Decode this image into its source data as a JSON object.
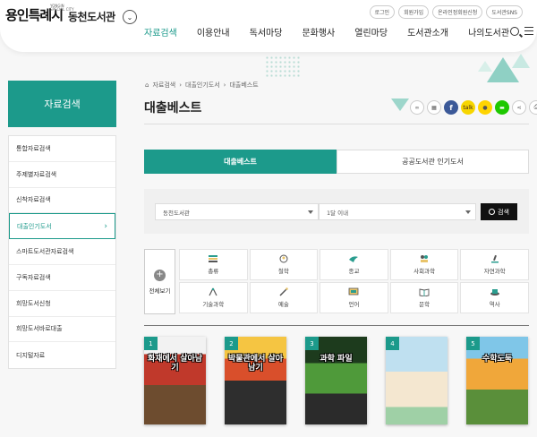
{
  "logo": {
    "main": "용인특례시",
    "sub": "YONGIN SPECIAL CITY"
  },
  "library": {
    "name": "동천도서관"
  },
  "utils": [
    "로그인",
    "회원가입",
    "온라인정회원신청",
    "도서관SNS"
  ],
  "gnb": [
    "자료검색",
    "이용안내",
    "독서마당",
    "문화행사",
    "열린마당",
    "도서관소개",
    "나의도서관"
  ],
  "sidebar": {
    "title": "자료검색",
    "items": [
      "통합자료검색",
      "주제별자료검색",
      "신착자료검색",
      "대출인기도서",
      "스마트도서관자료검색",
      "구독자료검색",
      "희망도서신청",
      "희망도서바로대출",
      "디지털자료"
    ]
  },
  "breadcrumb": [
    "자료검색",
    "대출인기도서",
    "대출베스트"
  ],
  "page_title": "대출베스트",
  "share": {
    "facebook": "f",
    "kakao": "talk"
  },
  "tabs": [
    "대출베스트",
    "공공도서관 인기도서"
  ],
  "filter": {
    "library": "동천도서관",
    "period": "1달 이내",
    "search_label": "검색"
  },
  "categories": {
    "all_label": "전체보기",
    "items": [
      "총류",
      "철학",
      "종교",
      "사회과학",
      "자연과학",
      "기술과학",
      "예술",
      "언어",
      "문학",
      "역사"
    ]
  },
  "books": [
    {
      "rank": "1",
      "title": "화재에서 살아남기",
      "color": "#8a5a3a"
    },
    {
      "rank": "2",
      "title": "박물관에서 살아남기",
      "color": "#3a3a3a"
    },
    {
      "rank": "3",
      "title": "과학 파일",
      "color": "#2c5d2c"
    },
    {
      "rank": "4",
      "title": "",
      "color": "#cfe6f2"
    },
    {
      "rank": "5",
      "title": "수학도둑",
      "color": "#e8a33b"
    }
  ],
  "colors": {
    "accent": "#1c9a8b"
  }
}
